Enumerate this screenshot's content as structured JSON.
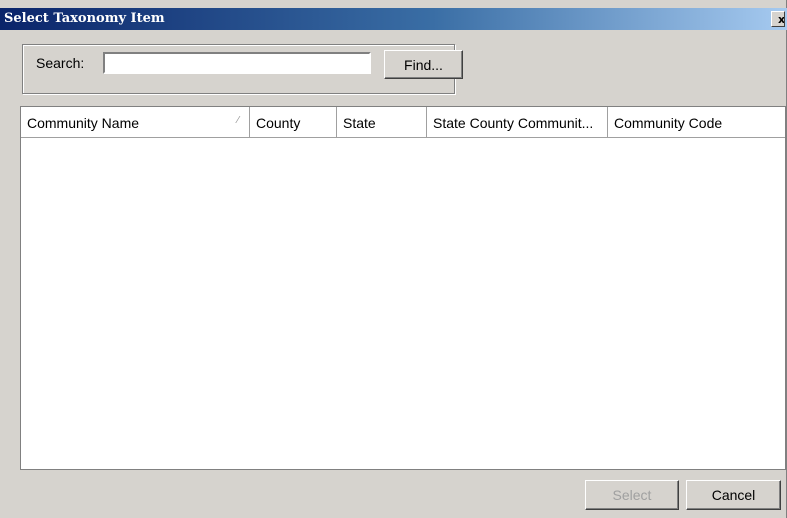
{
  "window": {
    "title": "Select Taxonomy Item",
    "close_glyph": "x"
  },
  "search": {
    "label": "Search:",
    "value": "",
    "placeholder": "",
    "find_label": "Find..."
  },
  "grid": {
    "columns": [
      {
        "label": "Community Name",
        "sort_icon": "sort-indicator-icon"
      },
      {
        "label": "County"
      },
      {
        "label": "State"
      },
      {
        "label": "State County Communit..."
      },
      {
        "label": "Community Code"
      }
    ],
    "rows": []
  },
  "footer": {
    "select_label": "Select",
    "select_enabled": false,
    "cancel_label": "Cancel"
  },
  "colors": {
    "dialog_bg": "#d6d3ce",
    "title_gradient_start": "#0a246a",
    "title_gradient_end": "#a6caf0",
    "disabled_text": "#a0a0a0"
  }
}
